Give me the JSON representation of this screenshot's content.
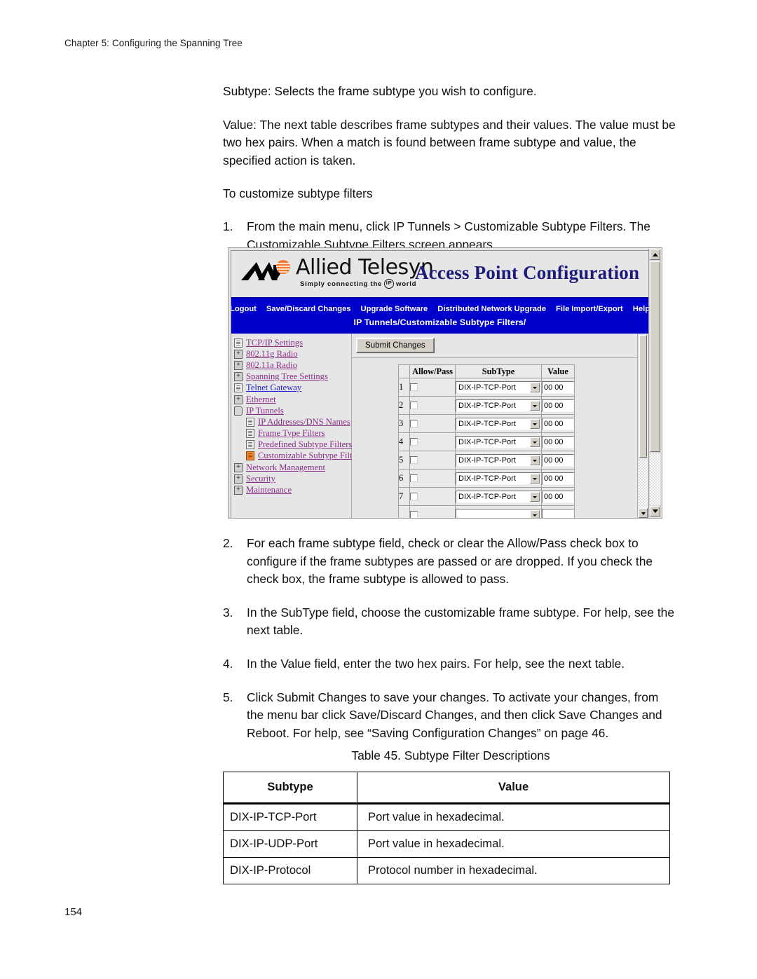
{
  "page": {
    "running_head": "Chapter 5: Configuring the Spanning Tree",
    "folio": "154"
  },
  "body": {
    "p1": "Subtype: Selects the frame subtype you wish to configure.",
    "p2": "Value: The next table describes frame subtypes and their values. The value must be two hex pairs. When a match is found between frame subtype and value, the specified action is taken.",
    "p3": "To customize subtype filters",
    "steps": [
      {
        "num": "1.",
        "text": "From the main menu, click IP Tunnels > Customizable Subtype Filters. The Customizable Subtype Filters screen appears."
      },
      {
        "num": "2.",
        "text": "For each frame subtype field, check or clear the Allow/Pass check box to configure if the frame subtypes are passed or are dropped. If you check the check box, the frame subtype is allowed to pass."
      },
      {
        "num": "3.",
        "text": "In the SubType field, choose the customizable frame subtype. For help, see the next table."
      },
      {
        "num": "4.",
        "text": "In the Value field, enter the two hex pairs. For help, see the next table."
      },
      {
        "num": "5.",
        "text": "Click Submit Changes to save your changes. To activate your changes, from the menu bar click Save/Discard Changes, and then click Save Changes and Reboot. For help, see “Saving Configuration Changes” on page 46."
      }
    ]
  },
  "screenshot": {
    "brand": {
      "word": "Allied Telesyn",
      "tagline_before": "Simply connecting the",
      "tagline_ring": "IP",
      "tagline_after": "world",
      "title": "Access Point Configuration",
      "title_color": "#1b1b7a",
      "logo_icon": "allied-telesyn-logo"
    },
    "menubar": {
      "items": [
        "Logout",
        "Save/Discard Changes",
        "Upgrade Software",
        "Distributed Network Upgrade",
        "File Import/Export",
        "Help"
      ],
      "bar_color": "#0000cc"
    },
    "breadcrumb": "IP Tunnels/Customizable Subtype Filters/",
    "nav": [
      {
        "label": "TCP/IP Settings",
        "icon": "page-icon",
        "indent": 0,
        "state": "visited"
      },
      {
        "label": "802.11g Radio",
        "icon": "folder-icon",
        "indent": 0,
        "state": "visited"
      },
      {
        "label": "802.11a Radio",
        "icon": "folder-icon",
        "indent": 0,
        "state": "visited"
      },
      {
        "label": "Spanning Tree Settings",
        "icon": "folder-icon",
        "indent": 0,
        "state": "visited"
      },
      {
        "label": "Telnet Gateway",
        "icon": "page-icon",
        "indent": 0,
        "state": "link"
      },
      {
        "label": "Ethernet",
        "icon": "folder-icon",
        "indent": 0,
        "state": "visited"
      },
      {
        "label": "IP Tunnels",
        "icon": "folder-open-icon",
        "indent": 0,
        "state": "visited"
      },
      {
        "label": "IP Addresses/DNS Names",
        "icon": "page-icon",
        "indent": 1,
        "state": "visited"
      },
      {
        "label": "Frame Type Filters",
        "icon": "page-icon",
        "indent": 1,
        "state": "visited"
      },
      {
        "label": "Predefined Subtype Filters",
        "icon": "page-icon",
        "indent": 1,
        "state": "visited"
      },
      {
        "label": "Customizable Subtype Filters",
        "icon": "current-page-icon",
        "indent": 1,
        "state": "current"
      },
      {
        "label": "Network Management",
        "icon": "folder-icon",
        "indent": 0,
        "state": "visited"
      },
      {
        "label": "Security",
        "icon": "folder-icon",
        "indent": 0,
        "state": "visited"
      },
      {
        "label": "Maintenance",
        "icon": "folder-icon",
        "indent": 0,
        "state": "visited"
      }
    ],
    "submit_label": "Submit Changes",
    "grid": {
      "headers": [
        "",
        "Allow/Pass",
        "SubType",
        "Value"
      ],
      "rows": [
        {
          "idx": "1",
          "allow": false,
          "subtype": "DIX-IP-TCP-Port",
          "value": "00 00"
        },
        {
          "idx": "2",
          "allow": false,
          "subtype": "DIX-IP-TCP-Port",
          "value": "00 00"
        },
        {
          "idx": "3",
          "allow": false,
          "subtype": "DIX-IP-TCP-Port",
          "value": "00 00"
        },
        {
          "idx": "4",
          "allow": false,
          "subtype": "DIX-IP-TCP-Port",
          "value": "00 00"
        },
        {
          "idx": "5",
          "allow": false,
          "subtype": "DIX-IP-TCP-Port",
          "value": "00 00"
        },
        {
          "idx": "6",
          "allow": false,
          "subtype": "DIX-IP-TCP-Port",
          "value": "00 00"
        },
        {
          "idx": "7",
          "allow": false,
          "subtype": "DIX-IP-TCP-Port",
          "value": "00 00"
        }
      ]
    }
  },
  "doc_table": {
    "caption": "Table 45. Subtype Filter Descriptions",
    "headers": [
      "Subtype",
      "Value"
    ],
    "rows": [
      [
        "DIX-IP-TCP-Port",
        "Port value in hexadecimal."
      ],
      [
        "DIX-IP-UDP-Port",
        "Port value in hexadecimal."
      ],
      [
        "DIX-IP-Protocol",
        "Protocol number in hexadecimal."
      ]
    ]
  }
}
